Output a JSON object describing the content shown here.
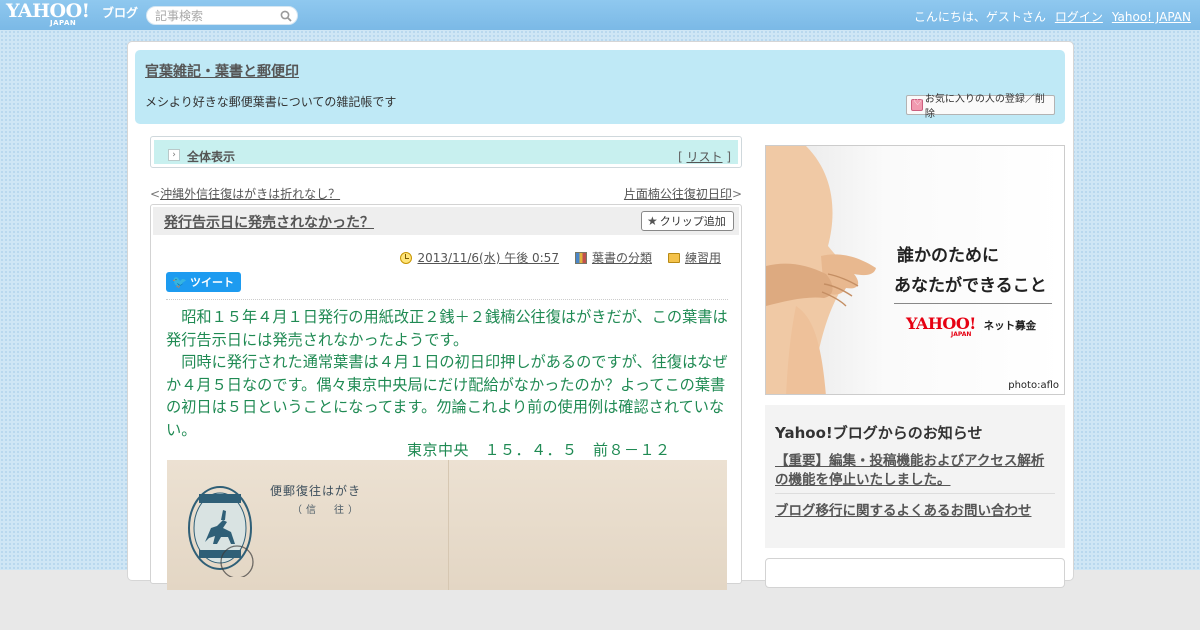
{
  "topbar": {
    "logo": {
      "brand": "YAHOO!",
      "sub": "JAPAN",
      "service": "ブログ"
    },
    "search": {
      "placeholder": "記事検索",
      "value": ""
    },
    "greeting": "こんにちは、ゲストさん",
    "login": "ログイン",
    "home_link": "Yahoo! JAPAN"
  },
  "blog": {
    "title": "官葉雑記・葉書と郵便印",
    "description": "メシより好きな郵便葉書についての雑記帳です",
    "favorite_button": "お気に入りの人の登録／削除"
  },
  "allview": {
    "label": "全体表示",
    "list_link": "リスト",
    "bracket_open": "[ ",
    "bracket_close": " ]"
  },
  "nav": {
    "prev_marker": "<",
    "prev_label": "沖縄外信往復はがきは折れなし？",
    "next_label": "片面楠公往復初日印",
    "next_marker": ">"
  },
  "article": {
    "title": "発行告示日に発売されなかった？",
    "clip_button": "クリップ追加",
    "date": "2013/11/6(水) 午後 0:57",
    "category": "葉書の分類",
    "folder": "練習用",
    "tweet": "ツイート",
    "paragraphs": [
      "　昭和１５年４月１日発行の用紙改正２銭＋２銭楠公往復はがきだが、この葉書は発行告示日には発売されなかったようです。",
      "　同時に発行された通常葉書は４月１日の初日印押しがあるのですが、往復はなぜか４月５日なのです。偶々東京中央局にだけ配給がなかったのか？よってこの葉書の初日は５日ということになってます。勿論これより前の使用例は確認されていない。"
    ],
    "postmark": "東京中央　１５．４．５　前８－１２",
    "postcard": {
      "title": "便郵復往はがき",
      "subtitle": "（信　往）"
    }
  },
  "ad": {
    "line1": "誰かのために",
    "line2": "あなたができること",
    "brand": "YAHOO!",
    "brand_sub": "JAPAN",
    "service": "ネット募金",
    "credit": "photo:aflo"
  },
  "notice": {
    "title": "Yahoo!ブログからのお知らせ",
    "items": [
      "【重要】編集・投稿機能およびアクセス解析の機能を停止いたしました。",
      "ブログ移行に関するよくあるお問い合わせ"
    ]
  },
  "colors": {
    "topbar": "#7fbde8",
    "header_band": "#bfe9f6",
    "allview_band": "#c8f0ef",
    "article_text": "#1f8a53",
    "tweet_button": "#1d9bf0"
  },
  "icons": [
    "search-icon",
    "heart-icon",
    "chevron-right-icon",
    "star-icon",
    "clock-icon",
    "books-icon",
    "folder-icon",
    "twitter-bird-icon"
  ]
}
